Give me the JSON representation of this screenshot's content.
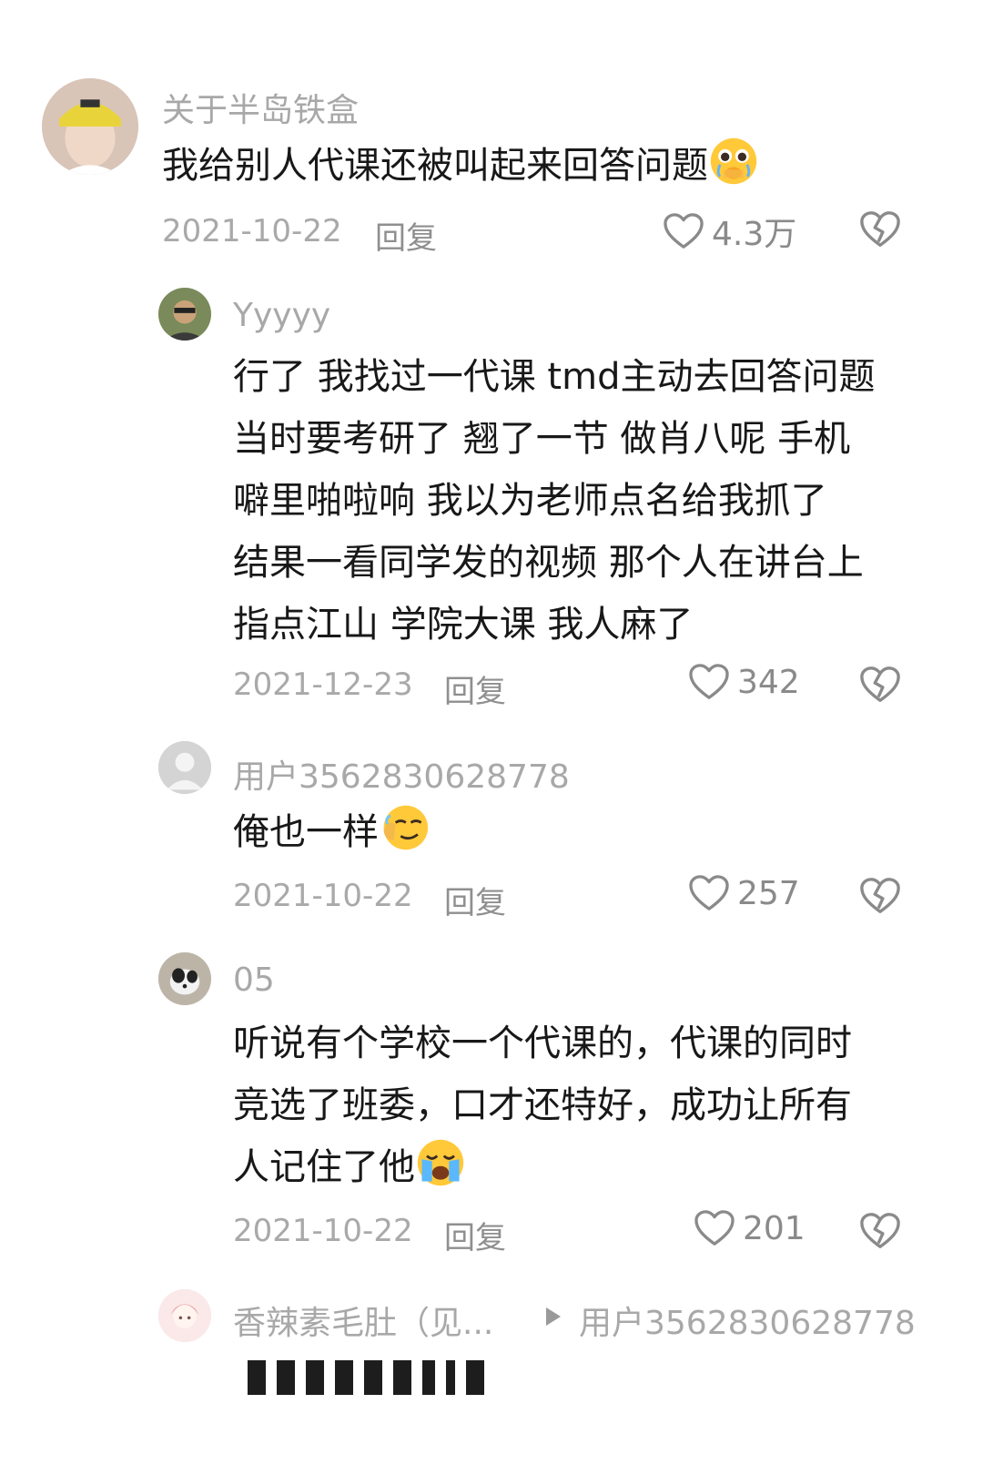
{
  "comments": [
    {
      "username": "关于半岛铁盒",
      "text_lines": [
        "我给别人代课还被叫起来回答问题"
      ],
      "emoji": "pleading-face-emoji",
      "date": "2021-10-22",
      "reply_label": "回复",
      "likes": "4.3万"
    },
    {
      "username": "Yyyyy",
      "text_lines": [
        "行了 我找过一代课 tmd主动去回答问题",
        "当时要考研了 翘了一节 做肖八呢 手机",
        "噼里啪啦响 我以为老师点名给我抓了",
        "结果一看同学发的视频 那个人在讲台上",
        "指点江山 学院大课 我人麻了"
      ],
      "date": "2021-12-23",
      "reply_label": "回复",
      "likes": "342"
    },
    {
      "username": "用户3562830628778",
      "text_lines": [
        "俺也一样"
      ],
      "emoji": "smirking-face-emoji",
      "date": "2021-10-22",
      "reply_label": "回复",
      "likes": "257"
    },
    {
      "username": "05",
      "text_lines": [
        "听说有个学校一个代课的，代课的同时",
        "竞选了班委，口才还特好，成功让所有",
        "人记住了他"
      ],
      "emoji": "crying-face-emoji",
      "date": "2021-10-22",
      "reply_label": "回复",
      "likes": "201"
    },
    {
      "username": "香辣素毛肚（见...",
      "reply_to": "用户3562830628778"
    }
  ],
  "icons": {
    "like": "heart-outline-icon",
    "dislike": "broken-heart-icon",
    "reply_arrow": "play-arrow-icon"
  },
  "colors": {
    "text": "#181818",
    "muted": "#a8a8a8",
    "background": "#ffffff"
  }
}
